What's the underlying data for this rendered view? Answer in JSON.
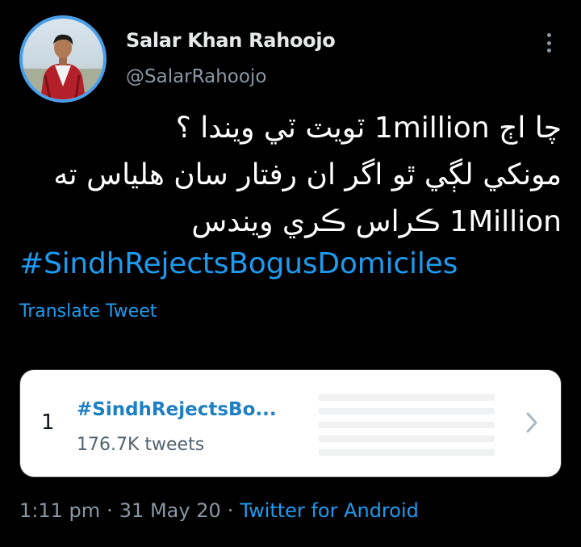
{
  "author": {
    "display_name": "Salar Khan Rahoojo",
    "handle": "@SalarRahoojo"
  },
  "tweet": {
    "lines": [
      "چا اڄ 1million ٽويٽ ٽي ويندا ؟",
      "مونکي لڳي ٿو اگر ان رفتار سان هلياس ته",
      "1Million ڪراس ڪري ويندس"
    ],
    "hashtag": "#SindhRejectsBogusDomiciles",
    "translate_label": "Translate Tweet"
  },
  "trend_card": {
    "rank": "1",
    "name": "#SindhRejectsBo...",
    "count": "176.7K tweets"
  },
  "meta": {
    "time": "1:11 pm",
    "separator": "·",
    "date": "31 May 20",
    "source": "Twitter for Android"
  },
  "colors": {
    "background": "#000000",
    "link": "#1d9bf0",
    "secondary_text": "#8b98a5",
    "avatar_ring": "#4a9ee8"
  },
  "icons": {
    "more": "more-vertical-icon",
    "chevron": "chevron-right-icon"
  }
}
